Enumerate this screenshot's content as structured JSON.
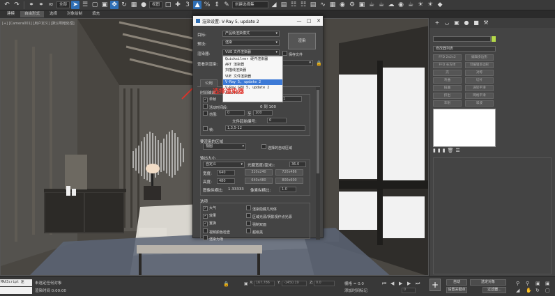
{
  "toolbar": {
    "selection_filter": "全部",
    "view_dropdown": "视图",
    "create_set": "创建选择集",
    "num": "3"
  },
  "menubar": {
    "items": [
      "建模",
      "自由形式",
      "选择",
      "对象绘制",
      "填充"
    ]
  },
  "viewport": {
    "label": "[+] [Camera001] [用户定义] [默认明暗处理]"
  },
  "dialog": {
    "title": "渲染设置: V-Ray 5, update 2",
    "target_label": "目标:",
    "target_value": "产品级渲染模式",
    "preset_label": "预设:",
    "preset_value": "渲染",
    "renderer_label": "渲染器:",
    "renderer_value": "VUE 文件渲染器",
    "save_file": "保存文件",
    "view_label": "查看到渲染:",
    "render_button": "渲染",
    "tab_common": "公用",
    "time_output": "时间输出",
    "single": "单帧",
    "active_segment": "活动时间段:",
    "range": "范围:",
    "range_from": "0",
    "range_to_label": "至",
    "range_to": "100",
    "file_start": "文件起始编号:",
    "file_start_val": "0",
    "frames": "帧:",
    "frames_val": "1,3,5-12",
    "every_nth": "每 N 帧:",
    "every_nth_val": "1",
    "active_seg_val": "0 到 100",
    "render_area": "要渲染的区域",
    "area_value": "视图",
    "auto_region": "选择的自动区域",
    "output_size": "输出大小",
    "custom": "自定义",
    "aperture": "光圈宽度(毫米):",
    "aperture_val": "36.0",
    "width_label": "宽度:",
    "width_val": "640",
    "height_label": "高度:",
    "height_val": "480",
    "preset_sizes": [
      "320x240",
      "720x486",
      "640x480",
      "800x600"
    ],
    "image_aspect": "图像纵横比:",
    "image_aspect_val": "1.33333",
    "pixel_aspect": "像素纵横比:",
    "pixel_aspect_val": "1.0",
    "options": "选项",
    "opt_atmos": "大气",
    "opt_hidden": "渲染隐藏几何体",
    "opt_effects": "效果",
    "opt_area_lights": "区域光源/阴影视作点光源",
    "opt_displace": "置换",
    "opt_force_2": "强制双面",
    "opt_video": "视频颜色检查",
    "opt_super": "超级黑",
    "opt_more": "渲染为场"
  },
  "dropdown": {
    "items": [
      "Quicksilver 硬件渲染器",
      "ART 渲染器",
      "扫描线渲染器",
      "VUE 文件渲染器",
      "V-Ray 5, update 2",
      "V-Ray GPU 5, update 2",
      "Arnold"
    ],
    "highlight_index": 4
  },
  "annotation": "选择渲染器",
  "cmdpanel": {
    "tabs": [
      "+",
      "modify-icon",
      "hierarchy-icon",
      "motion-icon",
      "display-icon",
      "utilities-icon"
    ],
    "list_label": "修改器列表",
    "buttons": [
      "FFD 2x2x2",
      "编辑多边形",
      "FFD 长方体",
      "可编辑多边形",
      "壳",
      "对称",
      "弯曲",
      "切片",
      "扭曲",
      "涡轮平滑",
      "挤出",
      "网格平滑",
      "车削",
      "噪波"
    ]
  },
  "statusbar": {
    "script": "MAXScript 迷",
    "none_selected": "未选定任何对象",
    "render_time": "渲染时间 0:00:00",
    "x_label": "X:",
    "x_val": "167.786",
    "y_label": "Y:",
    "y_val": "-1450.19",
    "z_label": "Z:",
    "z_val": "0.0",
    "grid": "栅格 = 0.0",
    "add_tag": "添加时间标记",
    "auto": "自动",
    "selected": "选定对象",
    "set_key": "设置关键点",
    "filters": "过滤器...",
    "frame": "0"
  }
}
